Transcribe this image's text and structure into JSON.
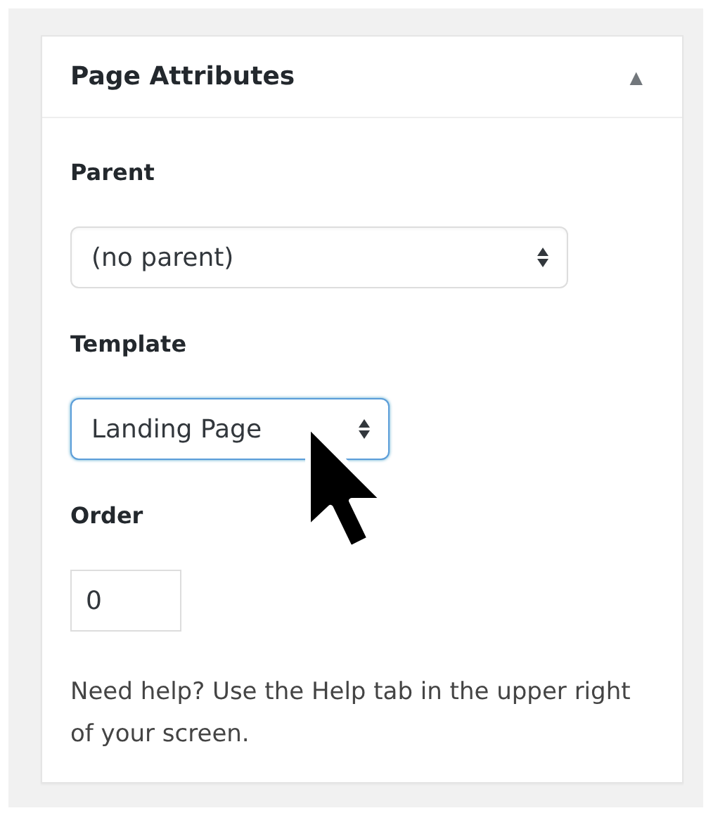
{
  "panel": {
    "title": "Page Attributes",
    "collapse_icon": "▲",
    "fields": [
      {
        "label": "Parent",
        "kind": "select",
        "value": "(no parent)",
        "focused": false
      },
      {
        "label": "Template",
        "kind": "select",
        "value": "Landing Page",
        "focused": true
      },
      {
        "label": "Order",
        "kind": "input",
        "value": "0",
        "focused": false
      }
    ],
    "help": "Need help? Use the Help tab in the upper right of your screen."
  }
}
